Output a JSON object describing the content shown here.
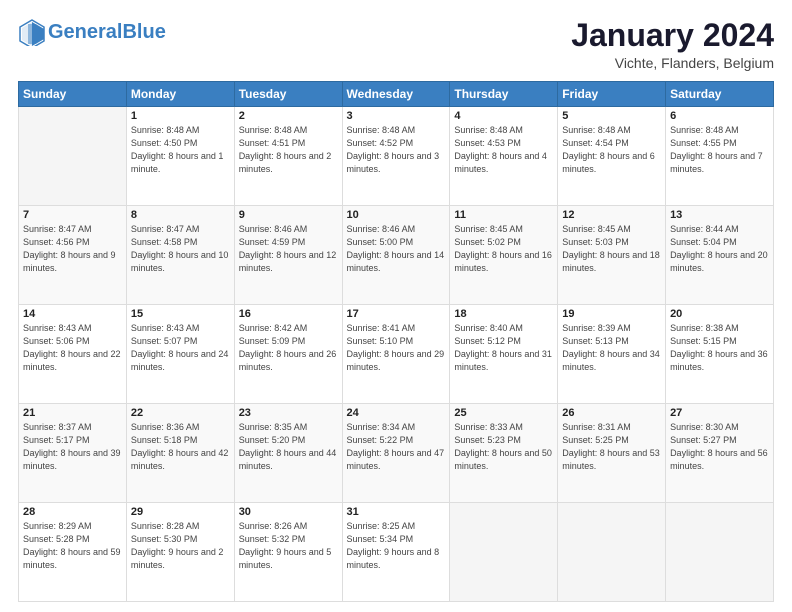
{
  "logo": {
    "line1": "General",
    "line2": "Blue"
  },
  "header": {
    "month_year": "January 2024",
    "location": "Vichte, Flanders, Belgium"
  },
  "days_of_week": [
    "Sunday",
    "Monday",
    "Tuesday",
    "Wednesday",
    "Thursday",
    "Friday",
    "Saturday"
  ],
  "weeks": [
    [
      {
        "day": "",
        "sunrise": "",
        "sunset": "",
        "daylight": ""
      },
      {
        "day": "1",
        "sunrise": "Sunrise: 8:48 AM",
        "sunset": "Sunset: 4:50 PM",
        "daylight": "Daylight: 8 hours and 1 minute."
      },
      {
        "day": "2",
        "sunrise": "Sunrise: 8:48 AM",
        "sunset": "Sunset: 4:51 PM",
        "daylight": "Daylight: 8 hours and 2 minutes."
      },
      {
        "day": "3",
        "sunrise": "Sunrise: 8:48 AM",
        "sunset": "Sunset: 4:52 PM",
        "daylight": "Daylight: 8 hours and 3 minutes."
      },
      {
        "day": "4",
        "sunrise": "Sunrise: 8:48 AM",
        "sunset": "Sunset: 4:53 PM",
        "daylight": "Daylight: 8 hours and 4 minutes."
      },
      {
        "day": "5",
        "sunrise": "Sunrise: 8:48 AM",
        "sunset": "Sunset: 4:54 PM",
        "daylight": "Daylight: 8 hours and 6 minutes."
      },
      {
        "day": "6",
        "sunrise": "Sunrise: 8:48 AM",
        "sunset": "Sunset: 4:55 PM",
        "daylight": "Daylight: 8 hours and 7 minutes."
      }
    ],
    [
      {
        "day": "7",
        "sunrise": "Sunrise: 8:47 AM",
        "sunset": "Sunset: 4:56 PM",
        "daylight": "Daylight: 8 hours and 9 minutes."
      },
      {
        "day": "8",
        "sunrise": "Sunrise: 8:47 AM",
        "sunset": "Sunset: 4:58 PM",
        "daylight": "Daylight: 8 hours and 10 minutes."
      },
      {
        "day": "9",
        "sunrise": "Sunrise: 8:46 AM",
        "sunset": "Sunset: 4:59 PM",
        "daylight": "Daylight: 8 hours and 12 minutes."
      },
      {
        "day": "10",
        "sunrise": "Sunrise: 8:46 AM",
        "sunset": "Sunset: 5:00 PM",
        "daylight": "Daylight: 8 hours and 14 minutes."
      },
      {
        "day": "11",
        "sunrise": "Sunrise: 8:45 AM",
        "sunset": "Sunset: 5:02 PM",
        "daylight": "Daylight: 8 hours and 16 minutes."
      },
      {
        "day": "12",
        "sunrise": "Sunrise: 8:45 AM",
        "sunset": "Sunset: 5:03 PM",
        "daylight": "Daylight: 8 hours and 18 minutes."
      },
      {
        "day": "13",
        "sunrise": "Sunrise: 8:44 AM",
        "sunset": "Sunset: 5:04 PM",
        "daylight": "Daylight: 8 hours and 20 minutes."
      }
    ],
    [
      {
        "day": "14",
        "sunrise": "Sunrise: 8:43 AM",
        "sunset": "Sunset: 5:06 PM",
        "daylight": "Daylight: 8 hours and 22 minutes."
      },
      {
        "day": "15",
        "sunrise": "Sunrise: 8:43 AM",
        "sunset": "Sunset: 5:07 PM",
        "daylight": "Daylight: 8 hours and 24 minutes."
      },
      {
        "day": "16",
        "sunrise": "Sunrise: 8:42 AM",
        "sunset": "Sunset: 5:09 PM",
        "daylight": "Daylight: 8 hours and 26 minutes."
      },
      {
        "day": "17",
        "sunrise": "Sunrise: 8:41 AM",
        "sunset": "Sunset: 5:10 PM",
        "daylight": "Daylight: 8 hours and 29 minutes."
      },
      {
        "day": "18",
        "sunrise": "Sunrise: 8:40 AM",
        "sunset": "Sunset: 5:12 PM",
        "daylight": "Daylight: 8 hours and 31 minutes."
      },
      {
        "day": "19",
        "sunrise": "Sunrise: 8:39 AM",
        "sunset": "Sunset: 5:13 PM",
        "daylight": "Daylight: 8 hours and 34 minutes."
      },
      {
        "day": "20",
        "sunrise": "Sunrise: 8:38 AM",
        "sunset": "Sunset: 5:15 PM",
        "daylight": "Daylight: 8 hours and 36 minutes."
      }
    ],
    [
      {
        "day": "21",
        "sunrise": "Sunrise: 8:37 AM",
        "sunset": "Sunset: 5:17 PM",
        "daylight": "Daylight: 8 hours and 39 minutes."
      },
      {
        "day": "22",
        "sunrise": "Sunrise: 8:36 AM",
        "sunset": "Sunset: 5:18 PM",
        "daylight": "Daylight: 8 hours and 42 minutes."
      },
      {
        "day": "23",
        "sunrise": "Sunrise: 8:35 AM",
        "sunset": "Sunset: 5:20 PM",
        "daylight": "Daylight: 8 hours and 44 minutes."
      },
      {
        "day": "24",
        "sunrise": "Sunrise: 8:34 AM",
        "sunset": "Sunset: 5:22 PM",
        "daylight": "Daylight: 8 hours and 47 minutes."
      },
      {
        "day": "25",
        "sunrise": "Sunrise: 8:33 AM",
        "sunset": "Sunset: 5:23 PM",
        "daylight": "Daylight: 8 hours and 50 minutes."
      },
      {
        "day": "26",
        "sunrise": "Sunrise: 8:31 AM",
        "sunset": "Sunset: 5:25 PM",
        "daylight": "Daylight: 8 hours and 53 minutes."
      },
      {
        "day": "27",
        "sunrise": "Sunrise: 8:30 AM",
        "sunset": "Sunset: 5:27 PM",
        "daylight": "Daylight: 8 hours and 56 minutes."
      }
    ],
    [
      {
        "day": "28",
        "sunrise": "Sunrise: 8:29 AM",
        "sunset": "Sunset: 5:28 PM",
        "daylight": "Daylight: 8 hours and 59 minutes."
      },
      {
        "day": "29",
        "sunrise": "Sunrise: 8:28 AM",
        "sunset": "Sunset: 5:30 PM",
        "daylight": "Daylight: 9 hours and 2 minutes."
      },
      {
        "day": "30",
        "sunrise": "Sunrise: 8:26 AM",
        "sunset": "Sunset: 5:32 PM",
        "daylight": "Daylight: 9 hours and 5 minutes."
      },
      {
        "day": "31",
        "sunrise": "Sunrise: 8:25 AM",
        "sunset": "Sunset: 5:34 PM",
        "daylight": "Daylight: 9 hours and 8 minutes."
      },
      {
        "day": "",
        "sunrise": "",
        "sunset": "",
        "daylight": ""
      },
      {
        "day": "",
        "sunrise": "",
        "sunset": "",
        "daylight": ""
      },
      {
        "day": "",
        "sunrise": "",
        "sunset": "",
        "daylight": ""
      }
    ]
  ]
}
